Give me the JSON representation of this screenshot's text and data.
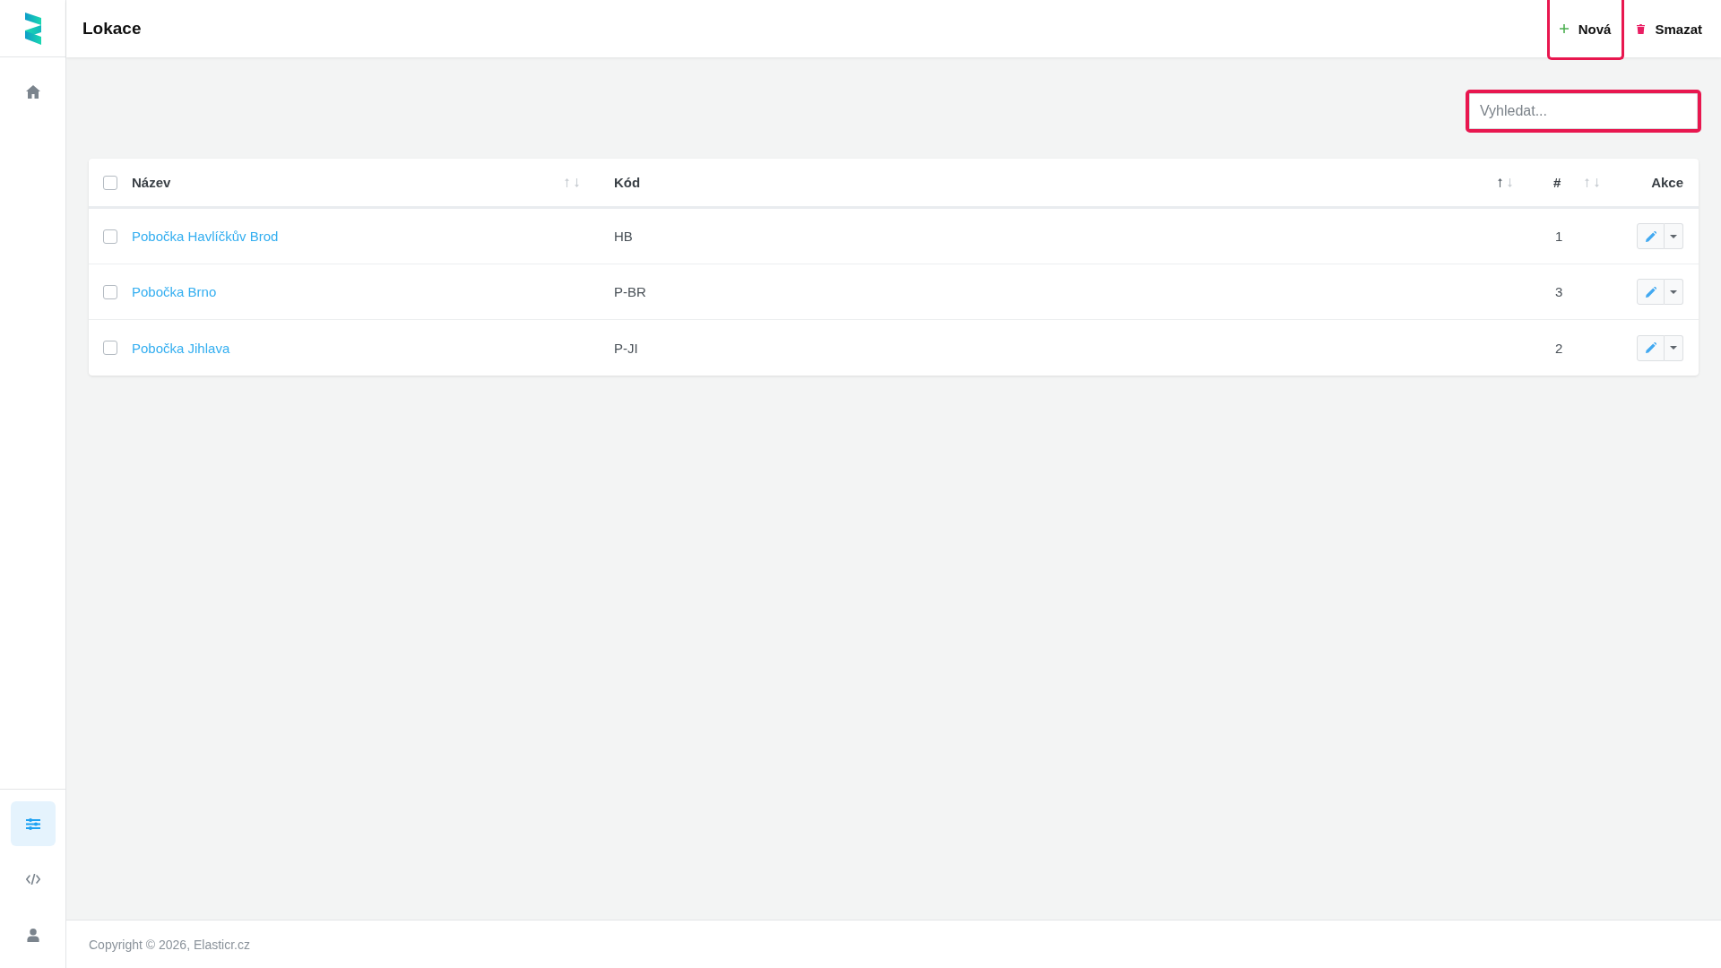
{
  "sidebar": {
    "items": [
      {
        "kind": "home",
        "selected": false
      }
    ],
    "bottom_items": [
      {
        "kind": "settings",
        "selected": true
      },
      {
        "kind": "code",
        "selected": false
      },
      {
        "kind": "user",
        "selected": false
      }
    ]
  },
  "header": {
    "title": "Lokace",
    "buttons": [
      {
        "kind": "new",
        "label": "Nová",
        "highlighted": true
      },
      {
        "kind": "delete",
        "label": "Smazat",
        "highlighted": false
      }
    ]
  },
  "search": {
    "placeholder": "Vyhledat...",
    "highlighted": true
  },
  "table": {
    "select_all": {
      "checked": false
    },
    "columns": [
      {
        "label": "Název",
        "sortable": true,
        "sorted_ascending": false
      },
      {
        "label": "Kód",
        "sortable": true,
        "sorted_ascending": true
      },
      {
        "label": "#",
        "sortable": true,
        "sorted_ascending": false
      },
      {
        "label": "Akce",
        "sortable": false
      }
    ],
    "rows": [
      {
        "checked": false,
        "name": "Pobočka Havlíčkův Brod",
        "code": "HB",
        "number": "1"
      },
      {
        "checked": false,
        "name": "Pobočka Brno",
        "code": "P-BR",
        "number": "3"
      },
      {
        "checked": false,
        "name": "Pobočka Jihlava",
        "code": "P-JI",
        "number": "2"
      }
    ]
  },
  "footer": {
    "text": "Copyright © 2026, Elasticr.cz"
  }
}
